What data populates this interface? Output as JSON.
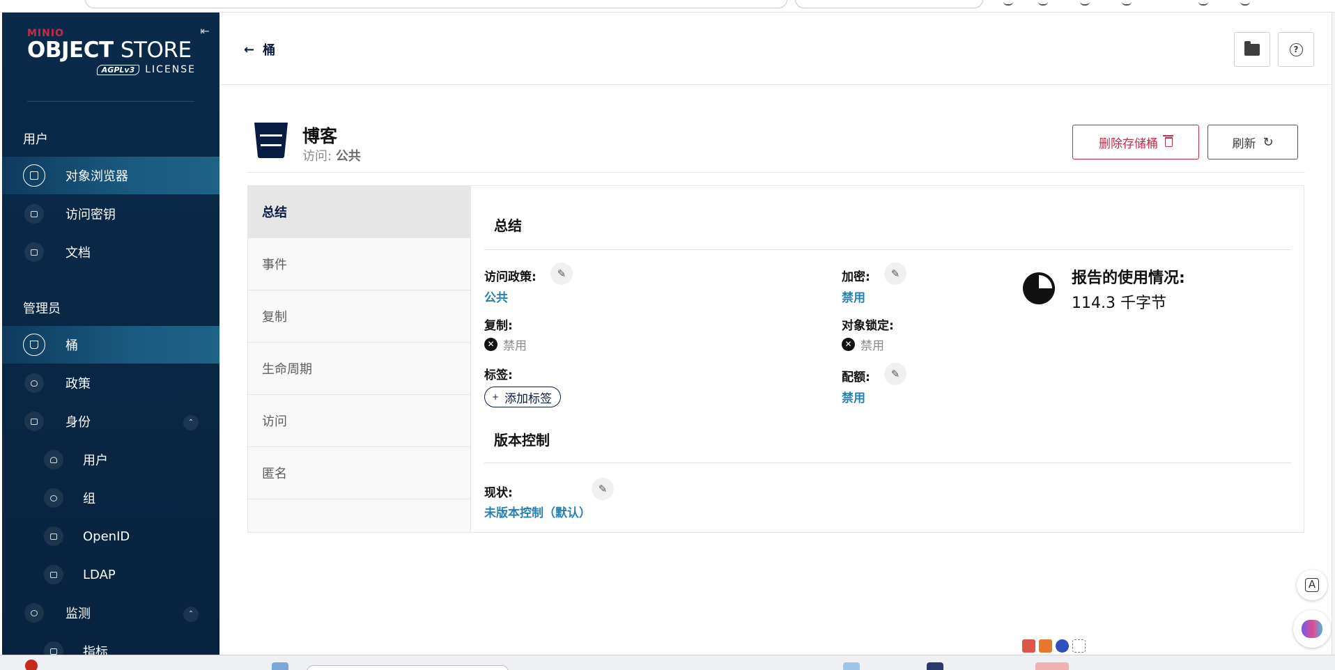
{
  "sidebar": {
    "logo": {
      "brand": "MINIO",
      "product_bold": "OBJECT",
      "product_light": "STORE",
      "license_badge": "AGPLv3",
      "license": "LICENSE"
    },
    "sections": [
      {
        "label": "用户",
        "items": [
          {
            "label": "对象浏览器",
            "icon": "object-browser-icon",
            "active": true
          },
          {
            "label": "访问密钥",
            "icon": "access-keys-icon",
            "active": false
          },
          {
            "label": "文档",
            "icon": "documentation-icon",
            "active": false
          }
        ]
      },
      {
        "label": "管理员",
        "items": [
          {
            "label": "桶",
            "icon": "bucket-icon",
            "active": true
          },
          {
            "label": "政策",
            "icon": "policy-icon",
            "active": false
          },
          {
            "label": "身份",
            "icon": "identity-icon",
            "active": false,
            "expanded": true
          },
          {
            "label": "用户",
            "icon": "user-icon",
            "sub": true
          },
          {
            "label": "组",
            "icon": "group-icon",
            "sub": true
          },
          {
            "label": "OpenID",
            "icon": "lock-icon",
            "sub": true
          },
          {
            "label": "LDAP",
            "icon": "login-icon",
            "sub": true
          },
          {
            "label": "监测",
            "icon": "monitoring-icon",
            "active": false,
            "expanded": true
          },
          {
            "label": "指标",
            "icon": "metrics-icon",
            "sub": true
          }
        ]
      }
    ]
  },
  "topbar": {
    "back_label": "桶",
    "folder_icon": "folder-icon",
    "help_icon": "help-icon"
  },
  "bucket": {
    "name": "博客",
    "access_label": "访问:",
    "access_value": "公共",
    "delete_label": "删除存储桶",
    "refresh_label": "刷新"
  },
  "tabs": [
    "总结",
    "事件",
    "复制",
    "生命周期",
    "访问",
    "匿名"
  ],
  "summary": {
    "title": "总结",
    "access_policy_label": "访问政策:",
    "access_policy_value": "公共",
    "replication_label": "复制:",
    "replication_value": "禁用",
    "tags_label": "标签:",
    "add_tag_label": "添加标签",
    "encryption_label": "加密:",
    "encryption_value": "禁用",
    "object_lock_label": "对象锁定:",
    "object_lock_value": "禁用",
    "quota_label": "配额:",
    "quota_value": "禁用",
    "usage_title": "报告的使用情况:",
    "usage_value": "114.3 千字节"
  },
  "versioning": {
    "title": "版本控制",
    "status_label": "现状:",
    "status_value": "未版本控制（默认）"
  },
  "colors": {
    "sidebar": "#0b2a4a",
    "accent_link": "#2781b0",
    "danger": "#c72c48",
    "navy": "#081c42"
  }
}
